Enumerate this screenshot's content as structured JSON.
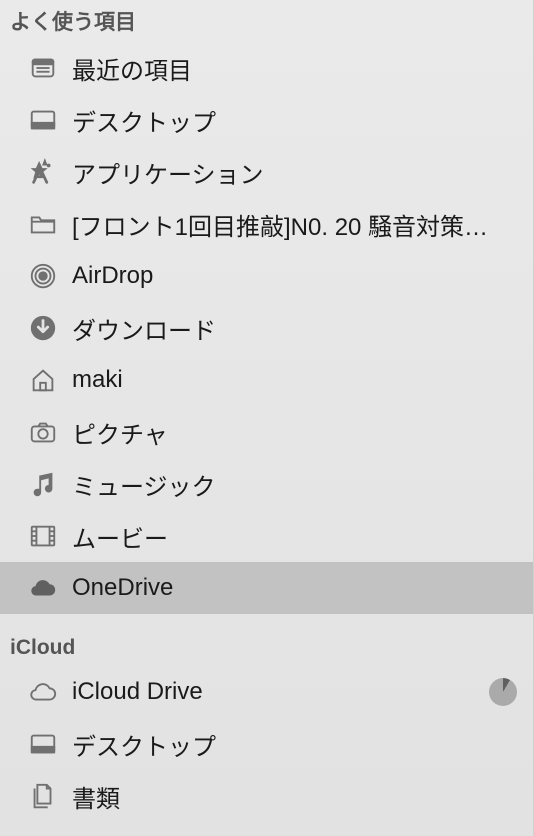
{
  "sections": [
    {
      "title": "よく使う項目",
      "items": [
        {
          "icon": "recent-icon",
          "label": "最近の項目",
          "selected": false
        },
        {
          "icon": "desktop-icon",
          "label": "デスクトップ",
          "selected": false
        },
        {
          "icon": "applications-icon",
          "label": "アプリケーション",
          "selected": false
        },
        {
          "icon": "folder-icon",
          "label": "[フロント1回目推敲]N0. 20 騒音対策…",
          "selected": false
        },
        {
          "icon": "airdrop-icon",
          "label": "AirDrop",
          "selected": false
        },
        {
          "icon": "download-icon",
          "label": "ダウンロード",
          "selected": false
        },
        {
          "icon": "home-icon",
          "label": "maki",
          "selected": false
        },
        {
          "icon": "pictures-icon",
          "label": "ピクチャ",
          "selected": false
        },
        {
          "icon": "music-icon",
          "label": "ミュージック",
          "selected": false
        },
        {
          "icon": "movies-icon",
          "label": "ムービー",
          "selected": false
        },
        {
          "icon": "cloud-icon",
          "label": "OneDrive",
          "selected": true
        }
      ]
    },
    {
      "title": "iCloud",
      "items": [
        {
          "icon": "cloud-outline-icon",
          "label": "iCloud Drive",
          "selected": false,
          "progress": true
        },
        {
          "icon": "desktop-icon",
          "label": "デスクトップ",
          "selected": false
        },
        {
          "icon": "documents-icon",
          "label": "書類",
          "selected": false
        }
      ]
    }
  ]
}
